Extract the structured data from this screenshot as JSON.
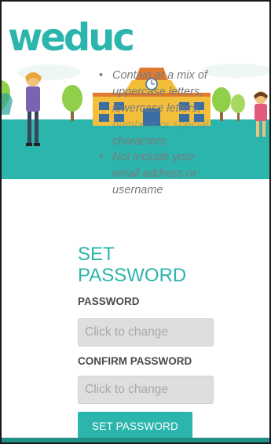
{
  "brand": {
    "logo_text": "weduc",
    "accent_color": "#2bb5ad"
  },
  "requirements": {
    "items": [
      {
        "lines": [
          "Contain at a mix of",
          "uppercase letters,",
          "lowercase letters,",
          "numbers or special",
          "characters"
        ]
      },
      {
        "lines": [
          "Not include your",
          "email address or",
          "username"
        ]
      }
    ]
  },
  "form": {
    "title_line1": "SET",
    "title_line2": "PASSWORD",
    "password_label": "PASSWORD",
    "password_placeholder": "Click to change",
    "confirm_label": "CONFIRM PASSWORD",
    "confirm_placeholder": "Click to change",
    "submit_label": "SET PASSWORD"
  }
}
